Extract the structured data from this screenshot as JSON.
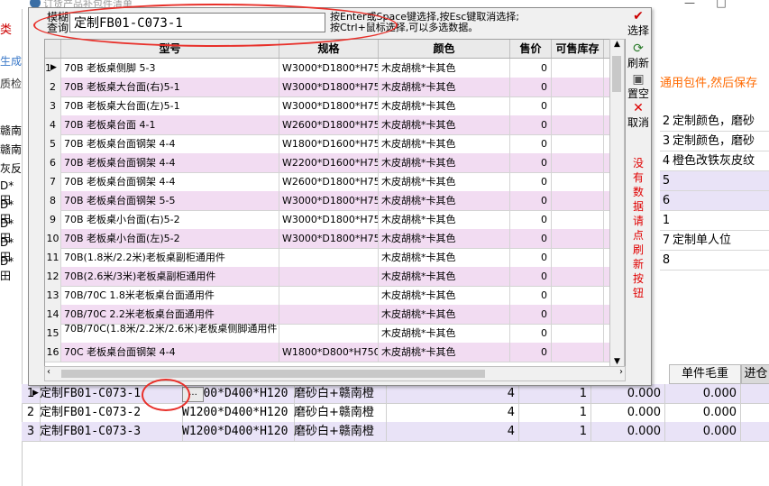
{
  "background": {
    "window_title": "订货产品补包件清单",
    "window_buttons": [
      "—",
      "□"
    ],
    "left_labels": [
      "类",
      "生成",
      "质检",
      "赣南",
      "赣南",
      "灰反",
      "D*田",
      "D*田",
      "D*田",
      "D*田",
      "D*田"
    ],
    "left_row_numbers": [
      "1",
      "2",
      "3",
      "8"
    ],
    "notice": "通用包件,然后保存",
    "right_rows": [
      {
        "num": "2",
        "text": "定制颜色，磨砂"
      },
      {
        "num": "3",
        "text": "定制颜色，磨砂"
      },
      {
        "num": "4",
        "text": "橙色改铁灰皮纹"
      },
      {
        "num": "5",
        "text": ""
      },
      {
        "num": "6",
        "text": ""
      },
      {
        "num": "1",
        "text": ""
      },
      {
        "num": "7",
        "text": "定制单人位"
      },
      {
        "num": "8",
        "text": ""
      }
    ],
    "col_header_weight": "单件毛重",
    "col_header_price": "进仓",
    "bottom_rows": [
      {
        "num": "1",
        "model": "定制FB01-C073-1",
        "spec": "W1200*D400*H120",
        "color": "磨砂白+赣南橙",
        "qty": "4",
        "q2": "1",
        "w1": "0.000",
        "w2": "0.000"
      },
      {
        "num": "2",
        "model": "定制FB01-C073-2",
        "spec": "W1200*D400*H120",
        "color": "磨砂白+赣南橙",
        "qty": "4",
        "q2": "1",
        "w1": "0.000",
        "w2": "0.000"
      },
      {
        "num": "3",
        "model": "定制FB01-C073-3",
        "spec": "W1200*D400*H120",
        "color": "磨砂白+赣南橙",
        "qty": "4",
        "q2": "1",
        "w1": "0.000",
        "w2": "0.000"
      }
    ],
    "ellipsis_label": "..."
  },
  "popup": {
    "lookup_label": "模糊查询",
    "lookup_value": "定制FB01-C073-1",
    "hint_line1": "按Enter或Space键选择,按Esc键取消选择;",
    "hint_line2": "按Ctrl+鼠标选择,可以多选数据。",
    "columns": [
      "型号",
      "规格",
      "颜色",
      "售价",
      "可售库存"
    ],
    "rows": [
      {
        "num": "1",
        "model": "70B 老板桌侧脚 5-3",
        "spec": "W3000*D1800*H750",
        "color": "木皮胡桃*卡其色",
        "price": "0",
        "stock": ""
      },
      {
        "num": "2",
        "model": "70B 老板桌大台面(右)5-1",
        "spec": "W3000*D1800*H750",
        "color": "木皮胡桃*卡其色",
        "price": "0",
        "stock": ""
      },
      {
        "num": "3",
        "model": "70B 老板桌大台面(左)5-1",
        "spec": "W3000*D1800*H750",
        "color": "木皮胡桃*卡其色",
        "price": "0",
        "stock": ""
      },
      {
        "num": "4",
        "model": "70B 老板桌台面 4-1",
        "spec": "W2600*D1800*H750",
        "color": "木皮胡桃*卡其色",
        "price": "0",
        "stock": ""
      },
      {
        "num": "5",
        "model": "70B 老板桌台面钢架 4-4",
        "spec": "W1800*D1600*H750",
        "color": "木皮胡桃*卡其色",
        "price": "0",
        "stock": ""
      },
      {
        "num": "6",
        "model": "70B 老板桌台面钢架 4-4",
        "spec": "W2200*D1600*H750",
        "color": "木皮胡桃*卡其色",
        "price": "0",
        "stock": ""
      },
      {
        "num": "7",
        "model": "70B 老板桌台面钢架 4-4",
        "spec": "W2600*D1800*H750",
        "color": "木皮胡桃*卡其色",
        "price": "0",
        "stock": ""
      },
      {
        "num": "8",
        "model": "70B 老板桌台面钢架 5-5",
        "spec": "W3000*D1800*H750",
        "color": "木皮胡桃*卡其色",
        "price": "0",
        "stock": ""
      },
      {
        "num": "9",
        "model": "70B 老板桌小台面(右)5-2",
        "spec": "W3000*D1800*H750",
        "color": "木皮胡桃*卡其色",
        "price": "0",
        "stock": ""
      },
      {
        "num": "10",
        "model": "70B 老板桌小台面(左)5-2",
        "spec": "W3000*D1800*H750",
        "color": "木皮胡桃*卡其色",
        "price": "0",
        "stock": ""
      },
      {
        "num": "11",
        "model": "70B(1.8米/2.2米)老板桌副柜通用件",
        "spec": "",
        "color": "木皮胡桃*卡其色",
        "price": "0",
        "stock": ""
      },
      {
        "num": "12",
        "model": "70B(2.6米/3米)老板桌副柜通用件",
        "spec": "",
        "color": "木皮胡桃*卡其色",
        "price": "0",
        "stock": ""
      },
      {
        "num": "13",
        "model": "70B/70C 1.8米老板桌台面通用件",
        "spec": "",
        "color": "木皮胡桃*卡其色",
        "price": "0",
        "stock": ""
      },
      {
        "num": "14",
        "model": "70B/70C 2.2米老板桌台面通用件",
        "spec": "",
        "color": "木皮胡桃*卡其色",
        "price": "0",
        "stock": ""
      },
      {
        "num": "15",
        "model": "70B/70C(1.8米/2.2米/2.6米)老板桌侧脚通用件",
        "spec": "",
        "color": "木皮胡桃*卡其色",
        "price": "0",
        "stock": ""
      },
      {
        "num": "16",
        "model": "70C 老板桌台面钢架 4-4",
        "spec": "W1800*D800*H750",
        "color": "木皮胡桃*卡其色",
        "price": "0",
        "stock": ""
      }
    ],
    "side": {
      "select": "选择",
      "refresh": "刷新",
      "clear": "置空",
      "cancel": "取消",
      "note": "没有数据请点刷新按钮"
    }
  }
}
